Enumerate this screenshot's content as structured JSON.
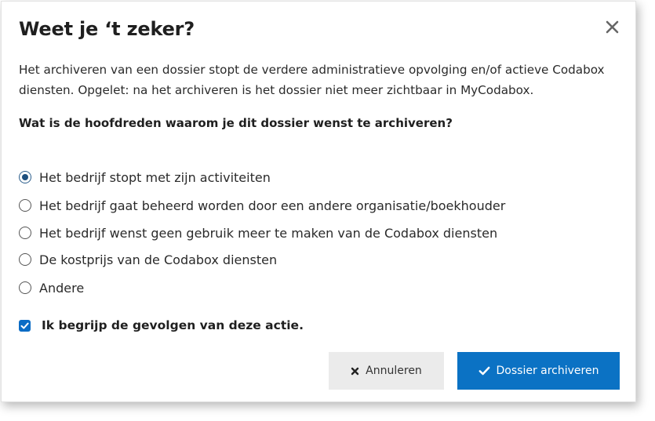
{
  "dialog": {
    "title": "Weet je ‘t zeker?",
    "description": "Het archiveren van een dossier stopt de verdere administratieve opvolging en/of actieve Codabox diensten. Opgelet: na het archiveren is het dossier niet meer zichtbaar in MyCodabox.",
    "question": "Wat is de hoofdreden waarom je dit dossier wenst te archiveren?",
    "close_icon": "close-icon"
  },
  "reasons": {
    "selected_index": 0,
    "options": [
      {
        "label": "Het bedrijf stopt met zijn activiteiten",
        "checked": true
      },
      {
        "label": "Het bedrijf gaat beheerd worden door een andere organisatie/boekhouder",
        "checked": false
      },
      {
        "label": "Het bedrijf wenst geen gebruik meer te maken van de Codabox diensten",
        "checked": false
      },
      {
        "label": "De kostprijs van de Codabox diensten",
        "checked": false
      },
      {
        "label": "Andere",
        "checked": false
      }
    ]
  },
  "confirm": {
    "label": "Ik begrijp de gevolgen van deze actie.",
    "checked": true
  },
  "buttons": {
    "cancel_label": "Annuleren",
    "cancel_icon": "times-icon",
    "submit_label": "Dossier archiveren",
    "submit_icon": "check-icon"
  },
  "colors": {
    "primary": "#0b72c4",
    "checkbox": "#0b6cc5",
    "radio_checked": "#1d4f7e",
    "cancel_bg": "#ebebeb"
  }
}
